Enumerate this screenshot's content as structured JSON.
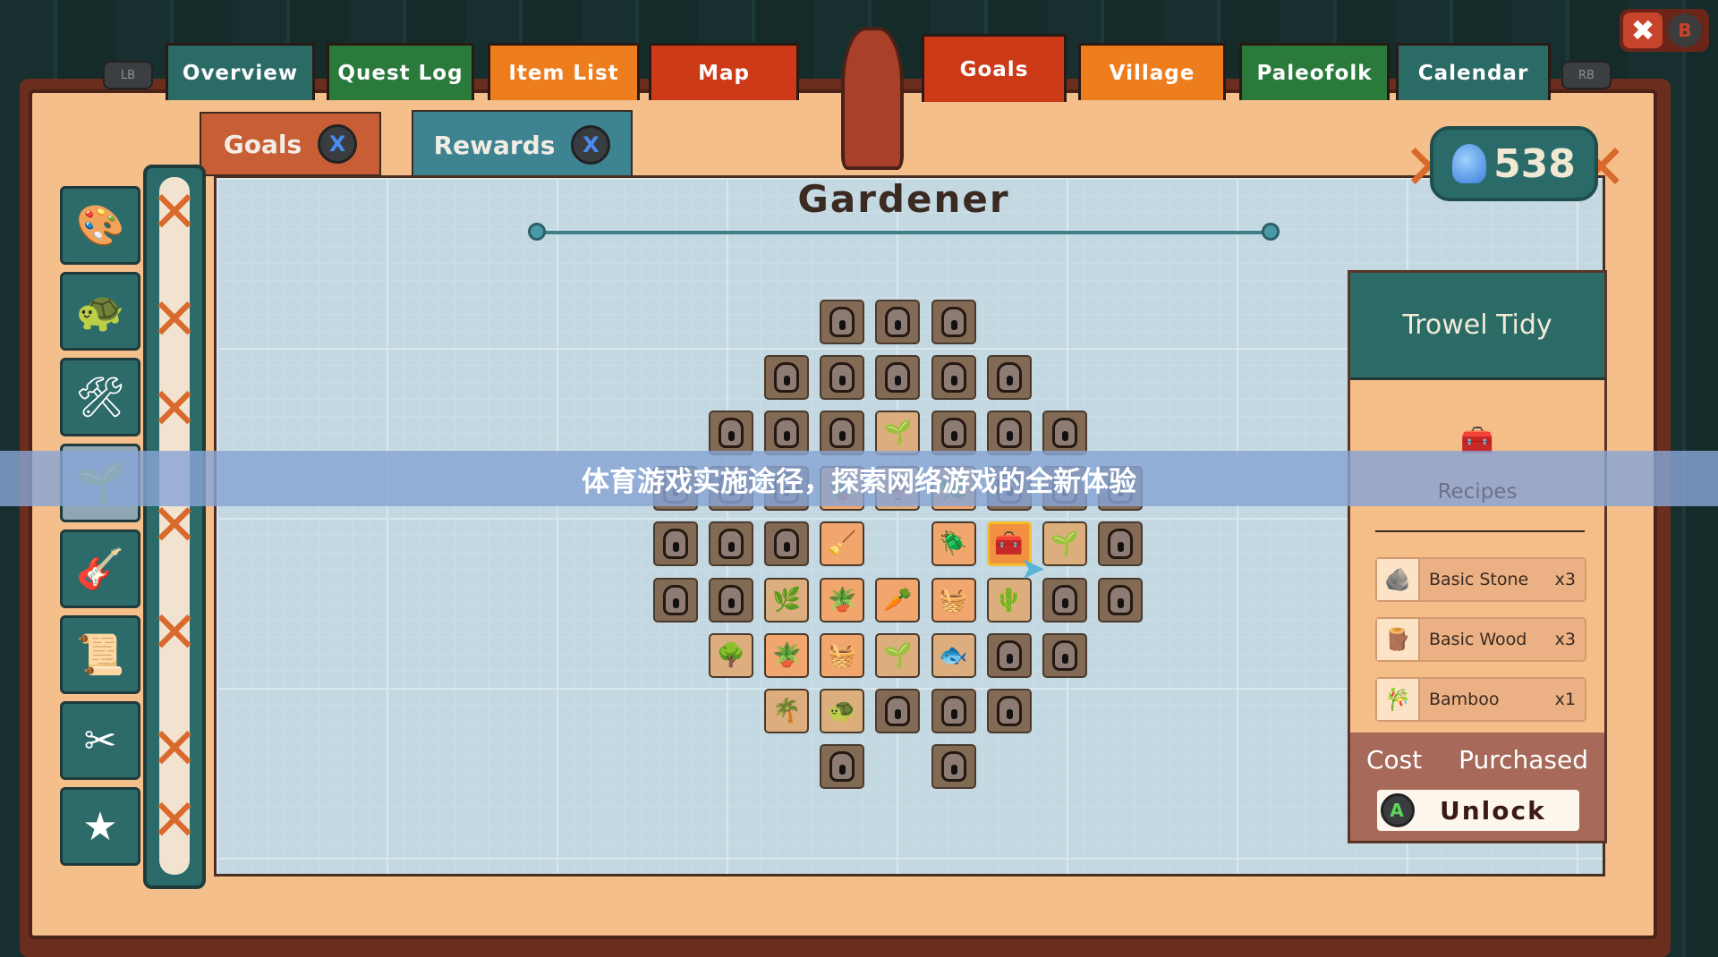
{
  "top_tabs": [
    {
      "label": "Overview",
      "color": "#2b6b66"
    },
    {
      "label": "Quest Log",
      "color": "#2a7a3c"
    },
    {
      "label": "Item List",
      "color": "#ee7d1e"
    },
    {
      "label": "Map",
      "color": "#cc3a18"
    },
    {
      "label": "Goals",
      "color": "#cc3a18",
      "selected": true
    },
    {
      "label": "Village",
      "color": "#ee7d1e"
    },
    {
      "label": "Paleofolk",
      "color": "#2a7a3c"
    },
    {
      "label": "Calendar",
      "color": "#2b6b66"
    }
  ],
  "shoulders": {
    "left": "LB",
    "right": "RB"
  },
  "close": {
    "icon": "close-icon",
    "button": "B"
  },
  "sub_tabs": [
    {
      "label": "Goals",
      "button": "X",
      "color": "#c75e35"
    },
    {
      "label": "Rewards",
      "button": "X",
      "color": "#3d8391"
    }
  ],
  "sidebar": {
    "items": [
      {
        "icon": "palette-icon",
        "glyph": "🎨"
      },
      {
        "icon": "creature-icon",
        "glyph": "🐢"
      },
      {
        "icon": "tools-icon",
        "glyph": "🛠"
      },
      {
        "icon": "sprout-icon",
        "glyph": "🌱",
        "selected": true
      },
      {
        "icon": "guitar-icon",
        "glyph": "🎸"
      },
      {
        "icon": "scroll-quill-icon",
        "glyph": "📜"
      },
      {
        "icon": "scissors-comb-icon",
        "glyph": "✂"
      },
      {
        "icon": "star-icon",
        "glyph": "★"
      }
    ]
  },
  "skill_tree": {
    "title": "Gardener",
    "rows": [
      [
        "",
        "",
        "",
        "L",
        "L",
        "L",
        "",
        "",
        ""
      ],
      [
        "",
        "",
        "L",
        "L",
        "L",
        "L",
        "L",
        "",
        ""
      ],
      [
        "",
        "L",
        "L",
        "L",
        "S:🌱",
        "L",
        "L",
        "L",
        ""
      ],
      [
        "L",
        "L",
        "L",
        "O:🪴",
        "S:🏺",
        "O:🌿",
        "L",
        "L",
        "L"
      ],
      [
        "L",
        "L",
        "L",
        "O:🧹",
        "",
        "O:🪲",
        "X:🧰",
        "S:🌱",
        "L"
      ],
      [
        "L",
        "L",
        "S:🌿",
        "O:🪴",
        "O:🥕",
        "O:🧺",
        "S:🌵",
        "L",
        "L"
      ],
      [
        "",
        "S:🌳",
        "O:🪴",
        "O:🧺",
        "S:🌱",
        "S:🐟",
        "L",
        "L",
        ""
      ],
      [
        "",
        "",
        "S:🌴",
        "S:🐢",
        "L",
        "L",
        "L",
        "",
        ""
      ],
      [
        "",
        "",
        "",
        "L",
        "",
        "L",
        "",
        "",
        ""
      ]
    ]
  },
  "currency": {
    "icon": "gem-icon",
    "value": "538"
  },
  "detail": {
    "name": "Trowel Tidy",
    "image": "trowel-tidy-icon",
    "recipes_label": "Recipes",
    "ingredients": [
      {
        "name": "Basic Stone",
        "qty": "x3",
        "icon": "stone-icon",
        "glyph": "🪨"
      },
      {
        "name": "Basic Wood",
        "qty": "x3",
        "icon": "wood-log-icon",
        "glyph": "🪵"
      },
      {
        "name": "Bamboo",
        "qty": "x1",
        "icon": "bamboo-icon",
        "glyph": "🎋"
      }
    ],
    "cost_label": "Cost",
    "cost_value": "Purchased",
    "unlock_button": "A",
    "unlock_label": "Unlock"
  },
  "banner": "体育游戏实施途径，探索网络游戏的全新体验"
}
